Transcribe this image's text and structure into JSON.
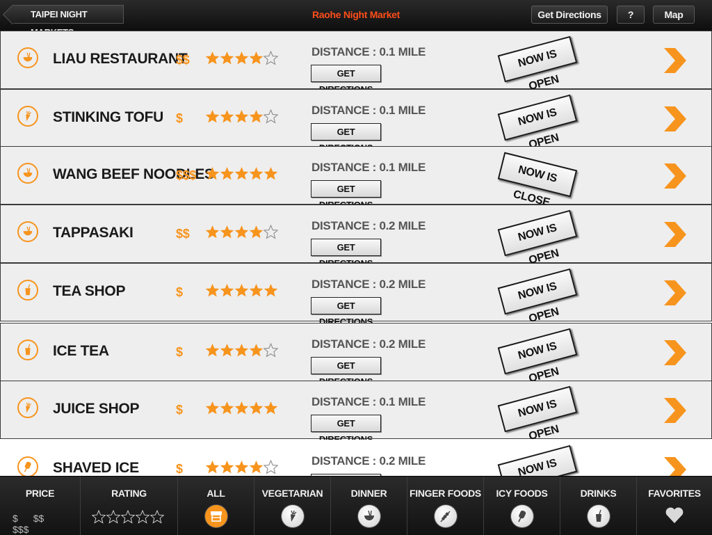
{
  "header": {
    "back_label": "Taipei Night Markets",
    "title": "Raohe Night Market",
    "get_directions_label": "Get Directions",
    "help_label": "?",
    "map_label": "Map"
  },
  "restaurants": [
    {
      "name": "Liau Restaurant",
      "category_icon": "noodle-bowl-icon",
      "price": "$$",
      "rating": 4,
      "distance": "Distance : 0.1 mile",
      "directions_label": "Get Directions",
      "status": "Now is open"
    },
    {
      "name": "Stinking Tofu",
      "category_icon": "carrot-icon",
      "price": "$",
      "rating": 4,
      "distance": "Distance : 0.1 mile",
      "directions_label": "Get Directions",
      "status": "Now is open"
    },
    {
      "name": "Wang Beef Noodles",
      "category_icon": "noodle-bowl-icon",
      "price": "$$$",
      "rating": 5,
      "distance": "Distance : 0.1 mile",
      "directions_label": "Get Directions",
      "status": "Now is close"
    },
    {
      "name": "Tappasaki",
      "category_icon": "noodle-bowl-icon",
      "price": "$$",
      "rating": 4,
      "distance": "Distance : 0.2 mile",
      "directions_label": "Get Directions",
      "status": "Now is open"
    },
    {
      "name": "Tea Shop",
      "category_icon": "drink-cup-icon",
      "price": "$",
      "rating": 5,
      "distance": "Distance : 0.2 mile",
      "directions_label": "Get Directions",
      "status": "Now is open"
    },
    {
      "name": "Ice Tea",
      "category_icon": "drink-cup-icon",
      "price": "$",
      "rating": 4,
      "distance": "Distance : 0.2 mile",
      "directions_label": "Get Directions",
      "status": "Now is open"
    },
    {
      "name": "Juice Shop",
      "category_icon": "carrot-icon",
      "price": "$",
      "rating": 5,
      "distance": "Distance : 0.1 mile",
      "directions_label": "Get Directions",
      "status": "Now is open"
    },
    {
      "name": "Shaved Ice",
      "category_icon": "ice-pop-icon",
      "price": "$",
      "rating": 4,
      "distance": "Distance : 0.2 mile",
      "directions_label": "Get Directions",
      "status": "Now is open"
    }
  ],
  "filters": {
    "price_label": "Price",
    "price_options": [
      "$",
      "$$",
      "$$$"
    ],
    "rating_label": "Rating",
    "rating_value": 0,
    "categories": [
      {
        "label": "All",
        "icon": "food-stall-icon",
        "active": true
      },
      {
        "label": "Vegetarian",
        "icon": "carrot-icon",
        "active": false
      },
      {
        "label": "Dinner",
        "icon": "noodle-bowl-icon",
        "active": false
      },
      {
        "label": "Finger Foods",
        "icon": "skewer-icon",
        "active": false
      },
      {
        "label": "Icy Foods",
        "icon": "ice-pop-icon",
        "active": false
      },
      {
        "label": "Drinks",
        "icon": "drink-cup-icon",
        "active": false
      },
      {
        "label": "Favorites",
        "icon": "heart-icon",
        "active": false
      }
    ]
  },
  "colors": {
    "accent": "#f7941d",
    "title": "#ff4e1a",
    "bar": "#1a1a1a"
  }
}
